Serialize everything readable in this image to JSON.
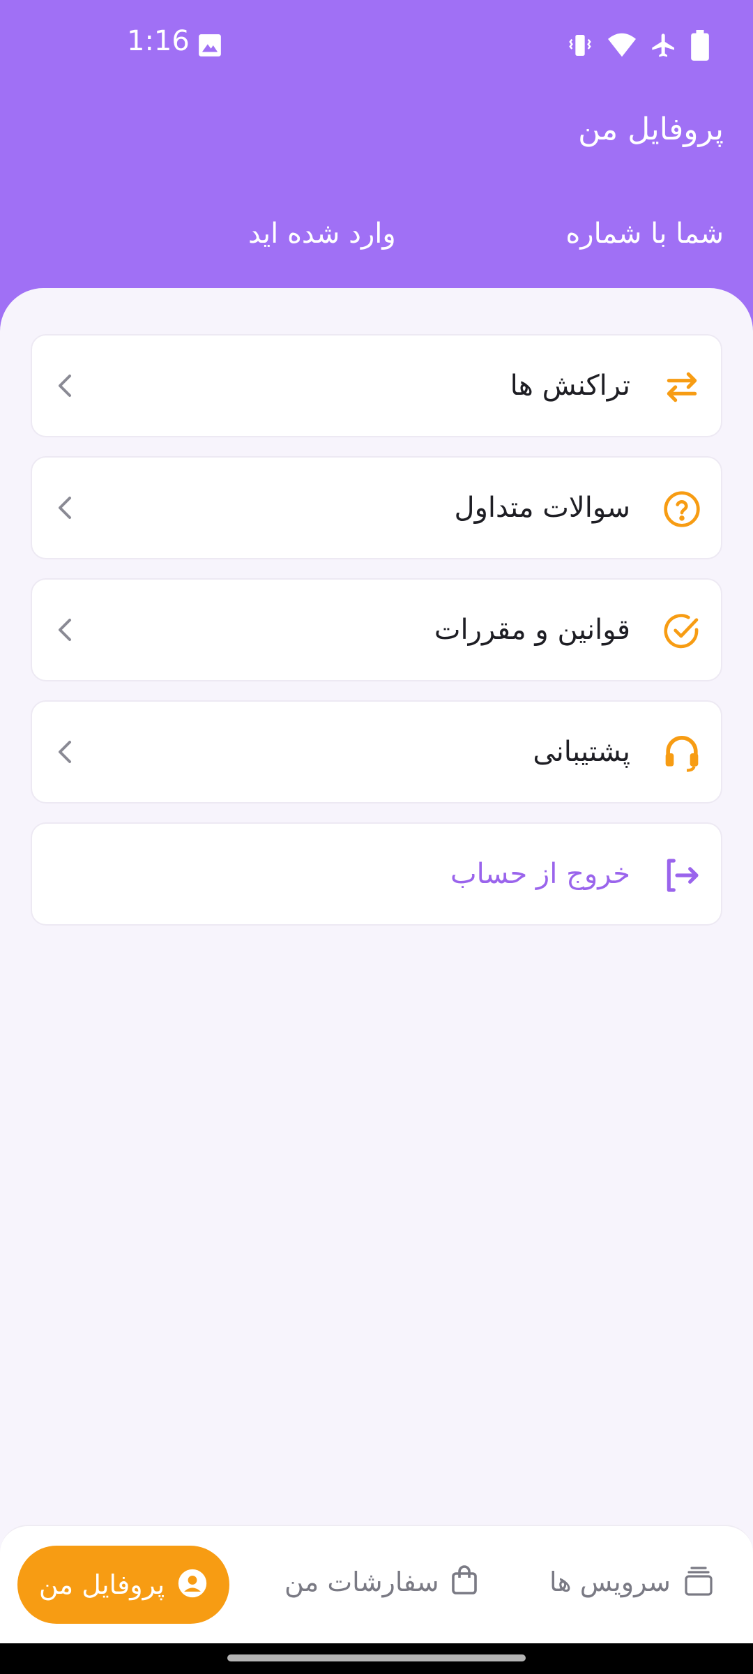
{
  "status_bar": {
    "time": "1:16",
    "left_icons": [
      "gallery-icon"
    ],
    "right_icons": [
      "vibrate-icon",
      "wifi-icon",
      "airplane-icon",
      "battery-icon"
    ]
  },
  "header": {
    "title": "پروفایل من",
    "phone_label": "شما با شماره",
    "logged_in_label": "وارد شده اید"
  },
  "menu": {
    "items": [
      {
        "label": "تراکنش ها",
        "icon": "swap-arrows-icon"
      },
      {
        "label": "سوالات متداول",
        "icon": "question-circle-icon"
      },
      {
        "label": "قوانین و مقررات",
        "icon": "check-circle-icon"
      },
      {
        "label": "پشتیبانی",
        "icon": "headset-icon"
      }
    ],
    "logout": {
      "label": "خروج از حساب",
      "icon": "logout-icon"
    }
  },
  "bottom_nav": {
    "items": [
      {
        "label": "پروفایل من",
        "icon": "user-circle-icon",
        "active": true
      },
      {
        "label": "سفارشات من",
        "icon": "shopping-bag-icon",
        "active": false
      },
      {
        "label": "سرویس ها",
        "icon": "stacked-cards-icon",
        "active": false
      }
    ]
  },
  "colors": {
    "header_bg": "#a070f5",
    "accent_orange": "#f79c13",
    "accent_purple": "#9a64ec",
    "background": "#f7f4fc"
  }
}
